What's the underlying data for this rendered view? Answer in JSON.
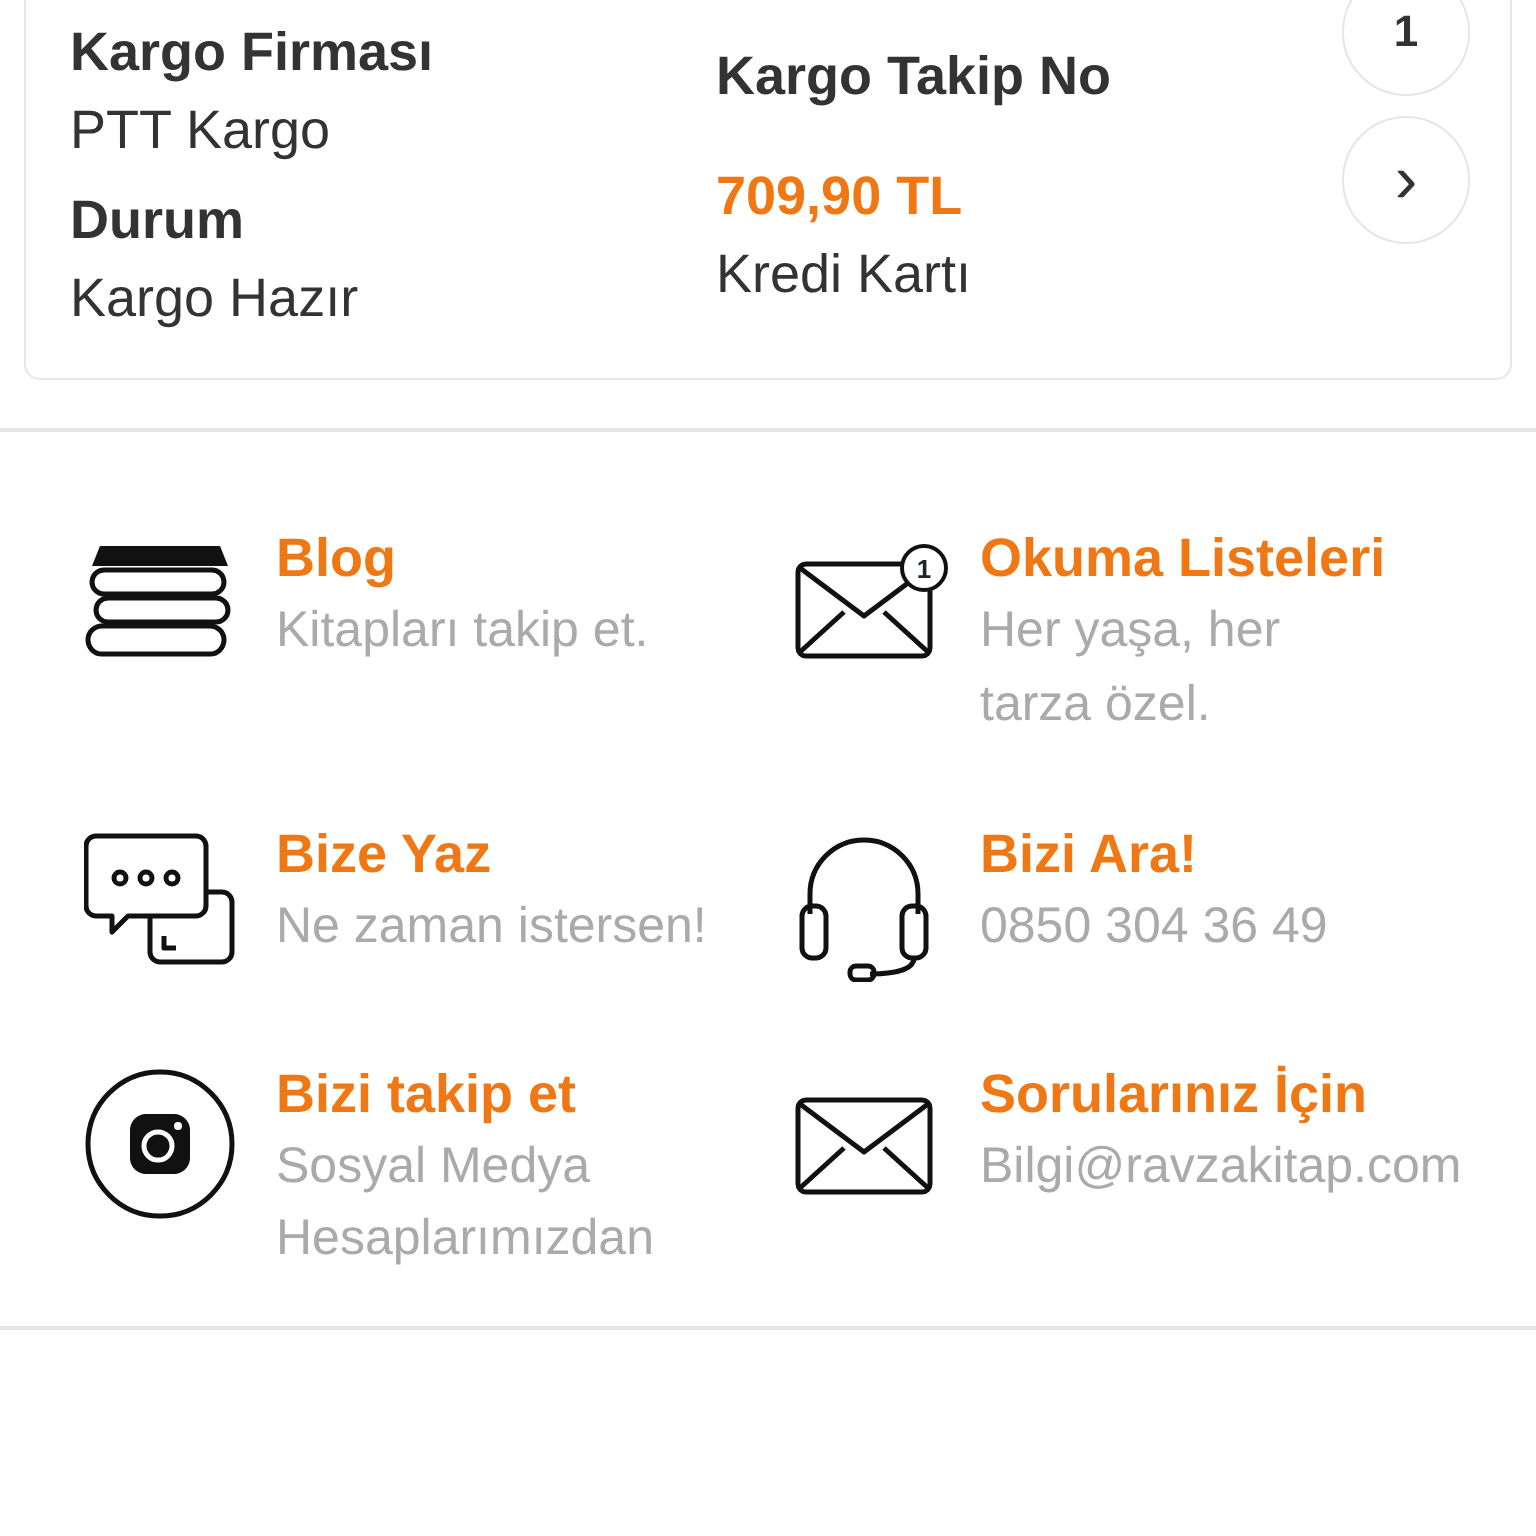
{
  "order_card": {
    "fields": [
      {
        "kind": "label",
        "label": "Kargo Firması",
        "value": "PTT Kargo"
      },
      {
        "kind": "label",
        "label": "Kargo Takip No"
      },
      {
        "kind": "label",
        "label": "Durum",
        "value": "Kargo Hazır"
      },
      {
        "kind": "price",
        "label": "709,90 TL",
        "value": "Kredi Kartı"
      }
    ],
    "buttons": [
      {
        "kind": "number",
        "text": "1"
      },
      {
        "kind": "chevron",
        "text": "›"
      }
    ]
  },
  "links": [
    {
      "kind": "books",
      "title": "Blog",
      "subtitle": "Kitapları takip et."
    },
    {
      "kind": "envelope",
      "badge": "1",
      "title": "Okuma Listeleri",
      "subtitle": "Her yaşa, her tarza özel."
    },
    {
      "kind": "chat",
      "title": "Bize Yaz",
      "subtitle": "Ne zaman istersen!"
    },
    {
      "kind": "headset",
      "title": "Bizi Ara!",
      "subtitle": "0850 304 36 49"
    },
    {
      "kind": "camera",
      "title": "Bizi takip et",
      "subtitle": "Sosyal Medya Hesaplarımızdan"
    },
    {
      "kind": "envelope",
      "title": "Sorularınız İçin",
      "subtitle": "Bilgi@ravzakitap.com"
    }
  ]
}
